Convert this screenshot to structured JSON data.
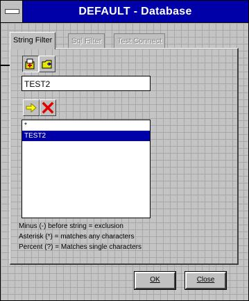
{
  "window": {
    "title": "DEFAULT - Database"
  },
  "tabs": [
    {
      "label": "String Filter",
      "state": "active"
    },
    {
      "label": "Sql Filter",
      "state": "disabled"
    },
    {
      "label": "Test Connect",
      "state": "disabled"
    }
  ],
  "toolbar": {
    "add_icon": "add-filter-icon",
    "browse_icon": "folder-browse-icon"
  },
  "filter_input": {
    "value": "TEST2"
  },
  "list_actions": {
    "add_icon": "yellow-arrow-icon",
    "delete_icon": "red-x-icon"
  },
  "filter_list": {
    "items": [
      "*",
      "TEST2"
    ],
    "selected_index": 1
  },
  "help": {
    "line1": "Minus (-) before string = exclusion",
    "line2": "Asterisk (*) = matches any characters",
    "line3": "Percent  (?) = Matches single characters"
  },
  "buttons": {
    "ok_label": "OK",
    "close_label": "Close"
  },
  "colors": {
    "titlebar": "#0000a8",
    "selection": "#0000a8",
    "face": "#c0c0c0"
  }
}
